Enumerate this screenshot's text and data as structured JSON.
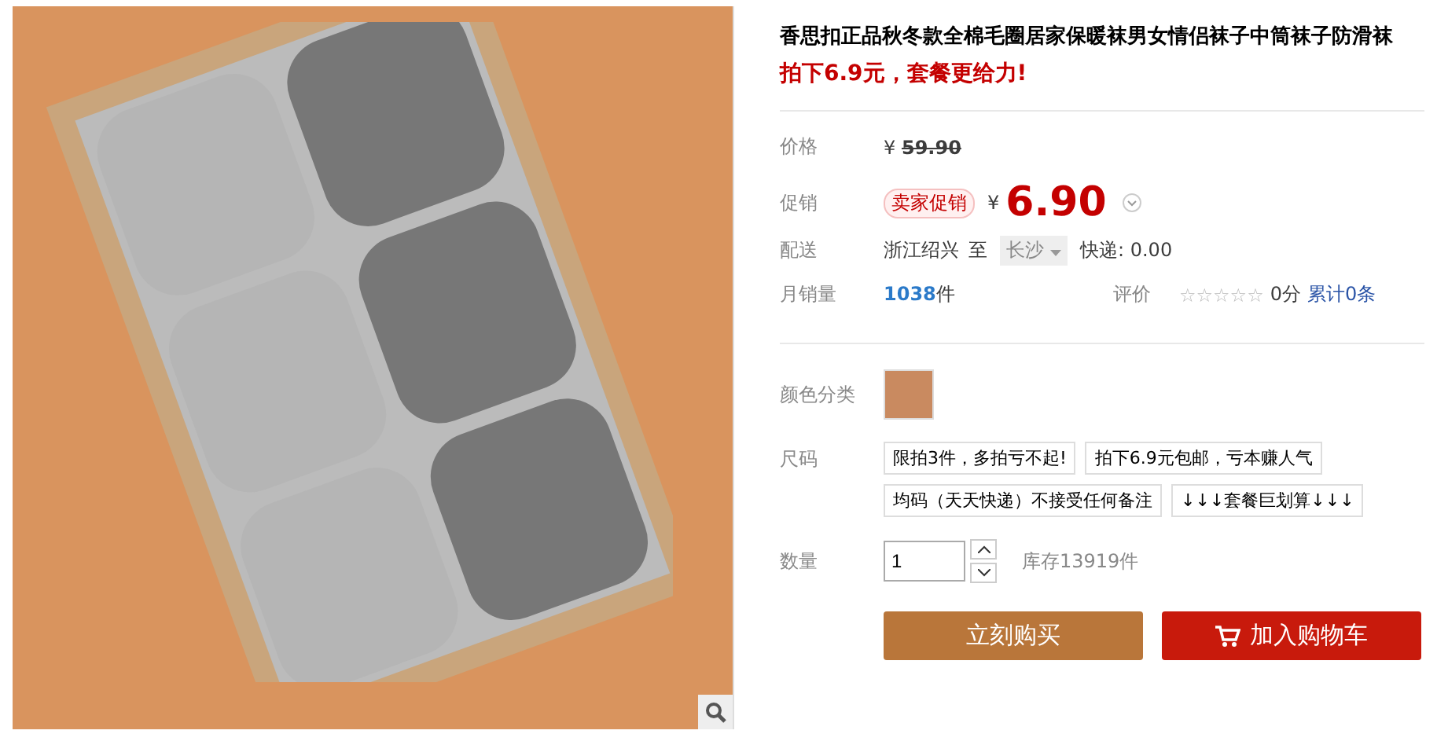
{
  "product": {
    "title": "香思扣正品秋冬款全棉毛圈居家保暖袜男女情侣袜子中筒袜子防滑袜",
    "subtitle": "拍下6.9元，套餐更给力!"
  },
  "price": {
    "label": "价格",
    "currency": "¥",
    "value": "59.90"
  },
  "promo": {
    "label": "促销",
    "tag": "卖家促销",
    "currency": "¥",
    "value": "6.90"
  },
  "shipping": {
    "label": "配送",
    "from": "浙江绍兴",
    "to_word": "至",
    "destination": "长沙",
    "method": "快递: 0.00"
  },
  "sales": {
    "label": "月销量",
    "count": "1038",
    "unit": "件",
    "rating_label": "评价",
    "stars": 0,
    "score": "0分",
    "reviews": "累计0条"
  },
  "color": {
    "label": "颜色分类"
  },
  "size": {
    "label": "尺码",
    "options": [
      {
        "text": "限拍3件，多拍亏不起!"
      },
      {
        "text": "拍下6.9元包邮，亏本赚人气"
      },
      {
        "text": "均码（天天快递）不接受任何备注"
      },
      {
        "text": "↓↓↓套餐巨划算↓↓↓"
      }
    ]
  },
  "quantity": {
    "label": "数量",
    "value": "1",
    "stock": "库存13919件"
  },
  "buttons": [
    {
      "kind": "buy",
      "label": "立刻购买"
    },
    {
      "kind": "cart",
      "label": "加入购物车"
    }
  ]
}
